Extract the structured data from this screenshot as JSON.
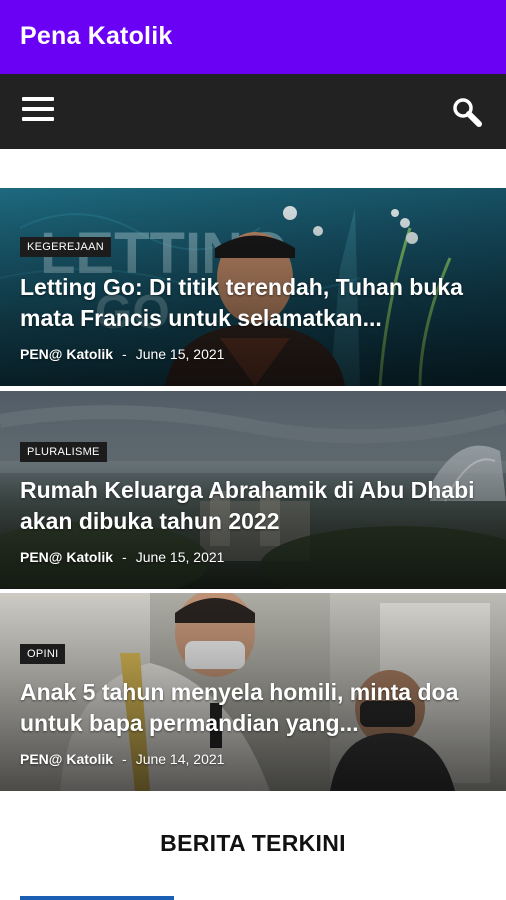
{
  "app": {
    "title": "Pena Katolik"
  },
  "toolbar": {
    "menu_icon": "hamburger-menu-icon",
    "search_icon": "search-icon"
  },
  "articles": [
    {
      "category": "KEGEREJAAN",
      "title": "Letting Go: Di titik terendah, Tuhan buka mata Francis untuk selamatkan...",
      "author": "PEN@ Katolik",
      "separator": "-",
      "date": "June 15, 2021"
    },
    {
      "category": "PLURALISME",
      "title": "Rumah Keluarga Abrahamik di Abu Dhabi akan dibuka tahun 2022",
      "author": "PEN@ Katolik",
      "separator": "-",
      "date": "June 15, 2021"
    },
    {
      "category": "OPINI",
      "title": "Anak 5 tahun menyela homili, minta doa untuk bapa permandian yang...",
      "author": "PEN@ Katolik",
      "separator": "-",
      "date": "June 14, 2021"
    }
  ],
  "section": {
    "title": "BERITA TERKINI"
  },
  "colors": {
    "appbar": "#6a00f4",
    "toolbar": "#222222",
    "accent": "#1a5fb4"
  }
}
